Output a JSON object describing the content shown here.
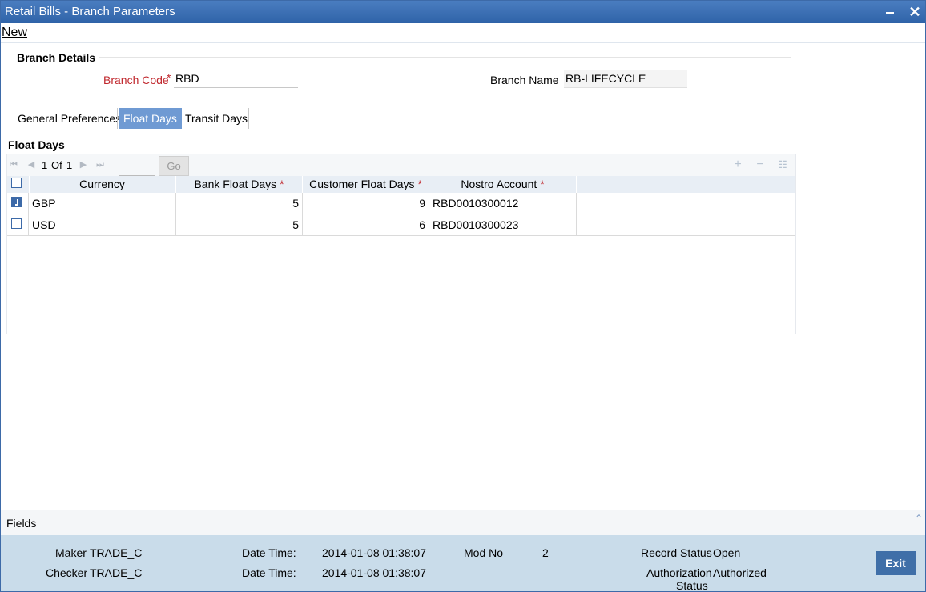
{
  "window": {
    "title": "Retail Bills - Branch Parameters",
    "minimize": "",
    "close": "✕"
  },
  "menu": {
    "new": "New"
  },
  "branch_details": {
    "section_title": "Branch Details",
    "branch_code_label": "Branch Code",
    "branch_code_value": "RBD",
    "branch_name_label": "Branch Name",
    "branch_name_value": "RB-LIFECYCLE",
    "required_mark": "*"
  },
  "tabs": [
    {
      "label": "General Preferences",
      "active": false
    },
    {
      "label": "Float Days",
      "active": true
    },
    {
      "label": "Transit Days",
      "active": false
    }
  ],
  "float_days": {
    "section_title": "Float Days",
    "pager": {
      "current": "1",
      "of": "Of",
      "total": "1",
      "go": "Go"
    },
    "icons": [
      "first-page-icon",
      "prev-page-icon",
      "next-page-icon",
      "last-page-icon",
      "add-row-icon",
      "delete-row-icon",
      "single-record-view-icon"
    ],
    "columns": {
      "currency": "Currency",
      "bank_float": "Bank Float Days",
      "customer_float": "Customer Float Days",
      "nostro": "Nostro Account"
    },
    "rows": [
      {
        "checked": true,
        "currency": "GBP",
        "bank_float": "5",
        "customer_float": "9",
        "nostro": "RBD0010300012"
      },
      {
        "checked": false,
        "currency": "USD",
        "bank_float": "5",
        "customer_float": "6",
        "nostro": "RBD0010300023"
      }
    ]
  },
  "fields_bar": {
    "label": "Fields"
  },
  "footer": {
    "maker_label": "Maker",
    "maker_value": "TRADE_C",
    "checker_label": "Checker",
    "checker_value": "TRADE_C",
    "datetime_label": "Date Time:",
    "maker_datetime": "2014-01-08 01:38:07",
    "checker_datetime": "2014-01-08 01:38:07",
    "mod_no_label": "Mod No",
    "mod_no_value": "2",
    "record_status_label": "Record Status",
    "record_status_value": "Open",
    "auth_status_label_1": "Authorization",
    "auth_status_label_2": "Status",
    "auth_status_value": "Authorized",
    "exit": "Exit"
  },
  "colors": {
    "title_bar": "#2f63a8",
    "active_tab": "#6f9ad3",
    "footer": "#c9dcea",
    "required": "#c0272d",
    "exit_button": "#3f6fa8"
  }
}
